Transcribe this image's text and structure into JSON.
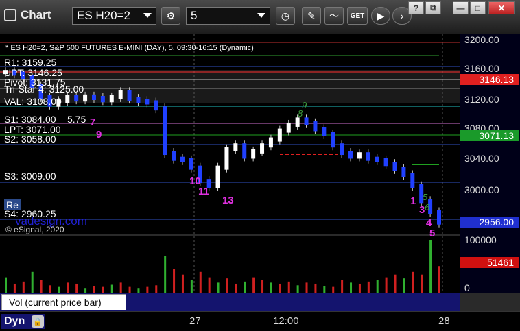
{
  "toolbar": {
    "title": "Chart",
    "symbol": "ES H20=2",
    "interval": "5",
    "window_buttons": [
      "?",
      "⧉",
      "—",
      "□",
      "✕"
    ]
  },
  "chart": {
    "header": "* ES H20=2, S&P 500 FUTURES E-MINI (DAY), 5, 09:30-16:15 (Dynamic)",
    "copyright": "© eSignal, 2020",
    "watermark": "vadesign.com",
    "levels": {
      "r1": "R1: 3159.25",
      "upt": "UPT: 3146.25",
      "pivot": "Pivot: 3131.75",
      "tri_star": "Tri-Star 4: 3125.00",
      "val": "VAL: 3108.00",
      "s1": "S1: 3084.00",
      "s1b": "5.75",
      "lpt": "LPT: 3071.00",
      "s2": "S2: 3058.00",
      "s3": "S3: 3009.00",
      "s4": "S4: 2960.25",
      "re": "Re"
    },
    "counts": [
      "7",
      "9",
      "10",
      "11",
      "13",
      "13",
      "1",
      "3",
      "4",
      "5"
    ],
    "green_counts": [
      "8",
      "9",
      "8",
      "6",
      "5"
    ]
  },
  "y_axis": {
    "labels": [
      "3200.00",
      "3160.00",
      "3120.00",
      "3080.00",
      "3040.00",
      "3000.00"
    ],
    "upt_tag": "3146.13",
    "lpt_tag": "3071.13",
    "last_tag": "2956.00",
    "vol_max": "100000",
    "vol_tag": "51461",
    "vol_zero": "0"
  },
  "x_axis": {
    "labels": [
      "27",
      "12:00",
      "28"
    ]
  },
  "legend": {
    "vol_label": "Vol (current price bar)",
    "close": "×"
  },
  "footer": {
    "mode": "Dyn"
  },
  "chart_data": {
    "type": "line",
    "title": "* ES H20=2, S&P 500 FUTURES E-MINI (DAY), 5, 09:30-16:15 (Dynamic)",
    "ylim": [
      2940,
      3210
    ],
    "series": [
      {
        "values": [
          3159,
          3157,
          3152,
          3140,
          3125,
          3115,
          3120,
          3125,
          3122,
          3126,
          3124,
          3121,
          3125,
          3132,
          3123,
          3120,
          3118,
          3110,
          3050,
          3042,
          3040,
          3030,
          3012,
          3005,
          3030,
          3055,
          3060,
          3045,
          3052,
          3060,
          3068,
          3080,
          3088,
          3095,
          3090,
          3082,
          3075,
          3060,
          3050,
          3045,
          3048,
          3042,
          3040,
          3035,
          3028,
          3020,
          3005,
          2985,
          2970,
          2956
        ]
      }
    ],
    "volume": [
      30,
      18,
      22,
      40,
      25,
      15,
      12,
      20,
      18,
      10,
      14,
      12,
      16,
      20,
      12,
      10,
      12,
      15,
      70,
      45,
      35,
      25,
      40,
      30,
      20,
      28,
      18,
      22,
      30,
      25,
      20,
      18,
      22,
      15,
      20,
      18,
      14,
      12,
      25,
      20,
      18,
      22,
      25,
      30,
      35,
      28,
      40,
      35,
      100,
      51
    ]
  }
}
